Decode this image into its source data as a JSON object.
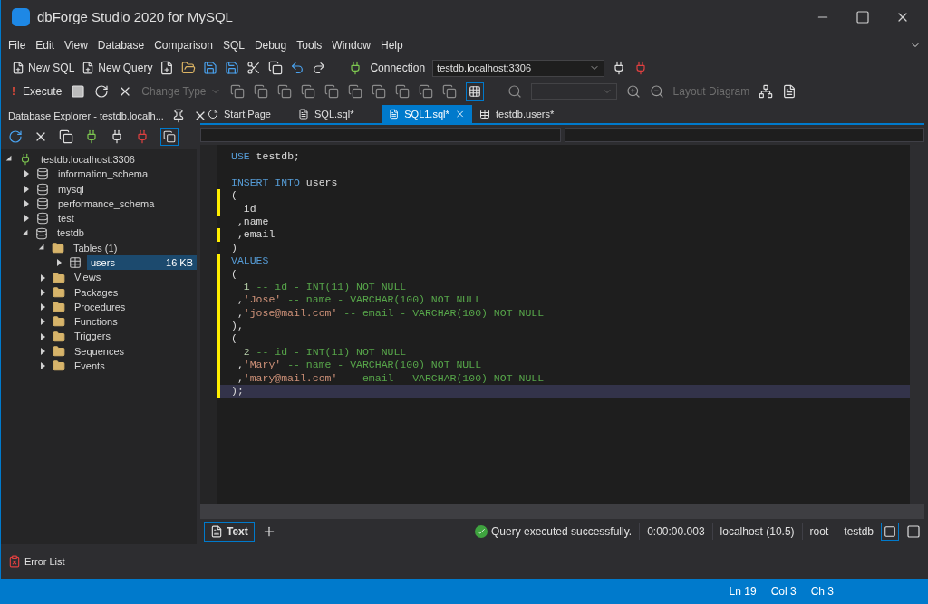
{
  "window": {
    "title": "dbForge Studio 2020 for MySQL"
  },
  "menu": [
    "File",
    "Edit",
    "View",
    "Database",
    "Comparison",
    "SQL",
    "Debug",
    "Tools",
    "Window",
    "Help"
  ],
  "toolbar": {
    "new_sql": "New SQL",
    "new_query": "New Query",
    "connection_label": "Connection",
    "connection_value": "testdb.localhost:3306",
    "execute": "Execute",
    "execute_glyph": "!",
    "change_type": {
      "label": "Change Type",
      "disabled": true
    },
    "layout_diagram": {
      "label": "Layout Diagram",
      "disabled": true
    }
  },
  "explorer": {
    "title": "Database Explorer - testdb.localh...",
    "tree": [
      {
        "label": "testdb.localhost:3306",
        "kind": "server",
        "expanded": true,
        "selected": false,
        "children": [
          {
            "label": "information_schema",
            "kind": "database",
            "expanded": false,
            "selected": false
          },
          {
            "label": "mysql",
            "kind": "database",
            "expanded": false,
            "selected": false
          },
          {
            "label": "performance_schema",
            "kind": "database",
            "expanded": false,
            "selected": false
          },
          {
            "label": "test",
            "kind": "database",
            "expanded": false,
            "selected": false
          },
          {
            "label": "testdb",
            "kind": "database",
            "expanded": true,
            "selected": false,
            "children": [
              {
                "label": "Tables (1)",
                "kind": "folder",
                "expanded": true,
                "selected": false,
                "children": [
                  {
                    "label": "users",
                    "kind": "table",
                    "expanded": false,
                    "selected": true,
                    "size": "16 KB"
                  }
                ]
              },
              {
                "label": "Views",
                "kind": "folder",
                "expanded": false,
                "selected": false
              },
              {
                "label": "Packages",
                "kind": "folder",
                "expanded": false,
                "selected": false
              },
              {
                "label": "Procedures",
                "kind": "folder",
                "expanded": false,
                "selected": false
              },
              {
                "label": "Functions",
                "kind": "folder",
                "expanded": false,
                "selected": false
              },
              {
                "label": "Triggers",
                "kind": "folder",
                "expanded": false,
                "selected": false
              },
              {
                "label": "Sequences",
                "kind": "folder",
                "expanded": false,
                "selected": false
              },
              {
                "label": "Events",
                "kind": "folder",
                "expanded": false,
                "selected": false
              }
            ]
          }
        ]
      }
    ]
  },
  "tabs": [
    {
      "label": "Start Page",
      "kind": "start",
      "selected": false
    },
    {
      "label": "SQL.sql*",
      "kind": "sql",
      "selected": false
    },
    {
      "label": "SQL1.sql*",
      "kind": "sql",
      "selected": true
    },
    {
      "label": "testdb.users*",
      "kind": "table",
      "selected": false
    }
  ],
  "editor": {
    "lines": [
      {
        "changed": false,
        "current": false,
        "tokens": [
          {
            "kind": "kw",
            "text": "USE"
          },
          {
            "kind": "id",
            "text": " testdb;"
          }
        ]
      },
      {
        "changed": false,
        "current": false
      },
      {
        "changed": false,
        "current": false,
        "tokens": [
          {
            "kind": "kw",
            "text": "INSERT INTO"
          },
          {
            "kind": "id",
            "text": " users"
          }
        ]
      },
      {
        "changed": true,
        "current": false,
        "tokens": [
          {
            "kind": "id",
            "text": "("
          }
        ]
      },
      {
        "changed": true,
        "current": false,
        "tokens": [
          {
            "kind": "id",
            "text": "  id"
          }
        ]
      },
      {
        "changed": false,
        "current": false,
        "tokens": [
          {
            "kind": "id",
            "text": " ,name"
          }
        ]
      },
      {
        "changed": true,
        "current": false,
        "tokens": [
          {
            "kind": "id",
            "text": " ,email"
          }
        ]
      },
      {
        "changed": false,
        "current": false,
        "tokens": [
          {
            "kind": "id",
            "text": ")"
          }
        ]
      },
      {
        "changed": true,
        "current": false,
        "tokens": [
          {
            "kind": "kw",
            "text": "VALUES"
          }
        ]
      },
      {
        "changed": true,
        "current": false,
        "tokens": [
          {
            "kind": "id",
            "text": "("
          }
        ]
      },
      {
        "changed": true,
        "current": false,
        "tokens": [
          {
            "kind": "num",
            "text": "  1"
          },
          {
            "kind": "cmt",
            "text": " -- id - INT(11) NOT NULL"
          }
        ]
      },
      {
        "changed": true,
        "current": false,
        "tokens": [
          {
            "kind": "id",
            "text": " ,"
          },
          {
            "kind": "str",
            "text": "'Jose'"
          },
          {
            "kind": "cmt",
            "text": " -- name - VARCHAR(100) NOT NULL"
          }
        ]
      },
      {
        "changed": true,
        "current": false,
        "tokens": [
          {
            "kind": "id",
            "text": " ,"
          },
          {
            "kind": "str",
            "text": "'jose@mail.com'"
          },
          {
            "kind": "cmt",
            "text": " -- email - VARCHAR(100) NOT NULL"
          }
        ]
      },
      {
        "changed": true,
        "current": false,
        "tokens": [
          {
            "kind": "id",
            "text": "),"
          }
        ]
      },
      {
        "changed": true,
        "current": false,
        "tokens": [
          {
            "kind": "id",
            "text": "("
          }
        ]
      },
      {
        "changed": true,
        "current": false,
        "tokens": [
          {
            "kind": "num",
            "text": "  2"
          },
          {
            "kind": "cmt",
            "text": " -- id - INT(11) NOT NULL"
          }
        ]
      },
      {
        "changed": true,
        "current": false,
        "tokens": [
          {
            "kind": "id",
            "text": " ,"
          },
          {
            "kind": "str",
            "text": "'Mary'"
          },
          {
            "kind": "cmt",
            "text": " -- name - VARCHAR(100) NOT NULL"
          }
        ]
      },
      {
        "changed": true,
        "current": false,
        "tokens": [
          {
            "kind": "id",
            "text": " ,"
          },
          {
            "kind": "str",
            "text": "'mary@mail.com'"
          },
          {
            "kind": "cmt",
            "text": " -- email - VARCHAR(100) NOT NULL"
          }
        ]
      },
      {
        "changed": true,
        "current": true,
        "tokens": [
          {
            "kind": "id",
            "text": ");"
          }
        ]
      }
    ]
  },
  "editor_status": {
    "view_tab": {
      "label": "Text",
      "selected": true
    },
    "message": "Query executed successfully.",
    "items": [
      "0:00:00.003",
      "localhost (10.5)",
      "root",
      "testdb"
    ]
  },
  "bottom_panel": {
    "tab": "Error List"
  },
  "status_bar": [
    "Ln 19",
    "Col 3",
    "Ch 3"
  ]
}
